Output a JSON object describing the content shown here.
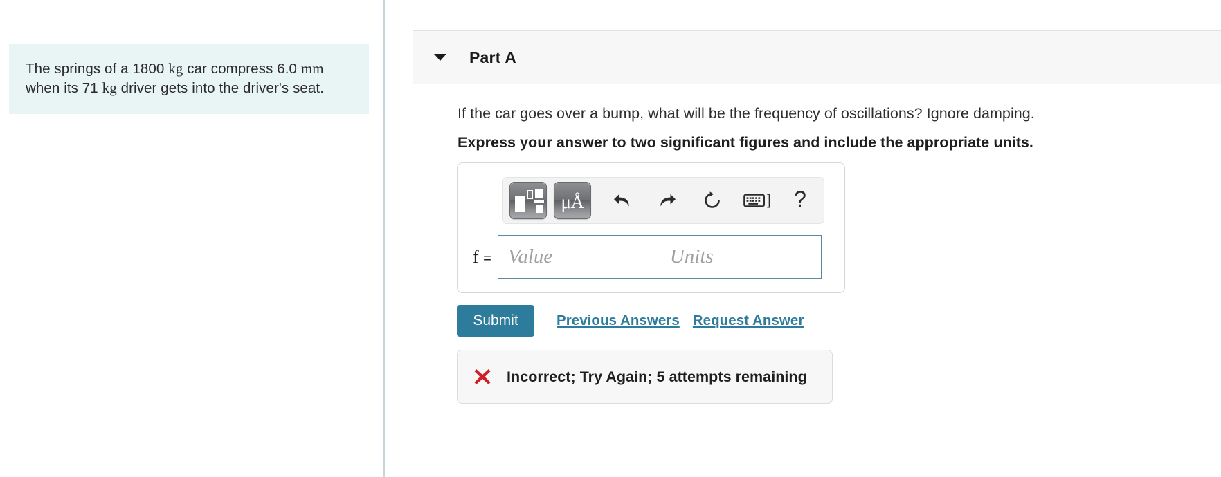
{
  "problem": {
    "segments": [
      {
        "text": "The springs of a 1800 ",
        "style": "plain"
      },
      {
        "text": "kg",
        "style": "unit"
      },
      {
        "text": " car compress 6.0 ",
        "style": "plain"
      },
      {
        "text": "mm",
        "style": "unit"
      },
      {
        "text": " when its 71 ",
        "style": "plain"
      },
      {
        "text": "kg",
        "style": "unit"
      },
      {
        "text": " driver gets into the driver's seat.",
        "style": "plain"
      }
    ],
    "line1_pre": "The springs of a 1800 ",
    "unit1": "kg",
    "line1_mid": " car compress 6.0 ",
    "unit2": "mm",
    "line2_pre": " when its 71 ",
    "unit3": "kg",
    "line2_post": " driver gets into the driver's seat.",
    "background_color": "#e9f4f5"
  },
  "part": {
    "title": "Part A",
    "toggle_icon": "chevron-down-triangle-icon",
    "expanded": true
  },
  "question": {
    "prompt": "If the car goes over a bump, what will be the frequency of oscillations? Ignore damping.",
    "instruction": "Express your answer to two significant figures and include the appropriate units."
  },
  "math_toolbar": {
    "buttons": [
      {
        "name": "math-template-button",
        "icon": "math-template-icon",
        "label": ""
      },
      {
        "name": "units-symbols-button",
        "icon": "mu-angstrom-icon",
        "label": "μÅ"
      },
      {
        "name": "undo-button",
        "icon": "undo-arrow-icon",
        "label": ""
      },
      {
        "name": "redo-button",
        "icon": "redo-arrow-icon",
        "label": ""
      },
      {
        "name": "reset-button",
        "icon": "reset-circular-arrow-icon",
        "label": ""
      },
      {
        "name": "keyboard-shortcuts-button",
        "icon": "keyboard-icon",
        "label": "]"
      },
      {
        "name": "help-button",
        "icon": "question-mark-icon",
        "label": "?"
      }
    ],
    "units_button_label": "μÅ",
    "keyboard_bracket": "]",
    "help_label": "?"
  },
  "answer": {
    "variable_label": "f",
    "equals": "=",
    "value_placeholder": "Value",
    "value": "",
    "units_placeholder": "Units",
    "units": "",
    "input_border_color": "#5a8a9e"
  },
  "actions": {
    "submit_label": "Submit",
    "previous_answers_label": "Previous Answers",
    "request_answer_label": "Request Answer",
    "submit_color": "#2e7c9c",
    "link_color": "#2e7c9c"
  },
  "feedback": {
    "icon": "red-x-mark-icon",
    "icon_glyph": "✖",
    "message": "Incorrect; Try Again; 5 attempts remaining",
    "status_color": "#cf2026",
    "attempts_remaining": 5
  }
}
